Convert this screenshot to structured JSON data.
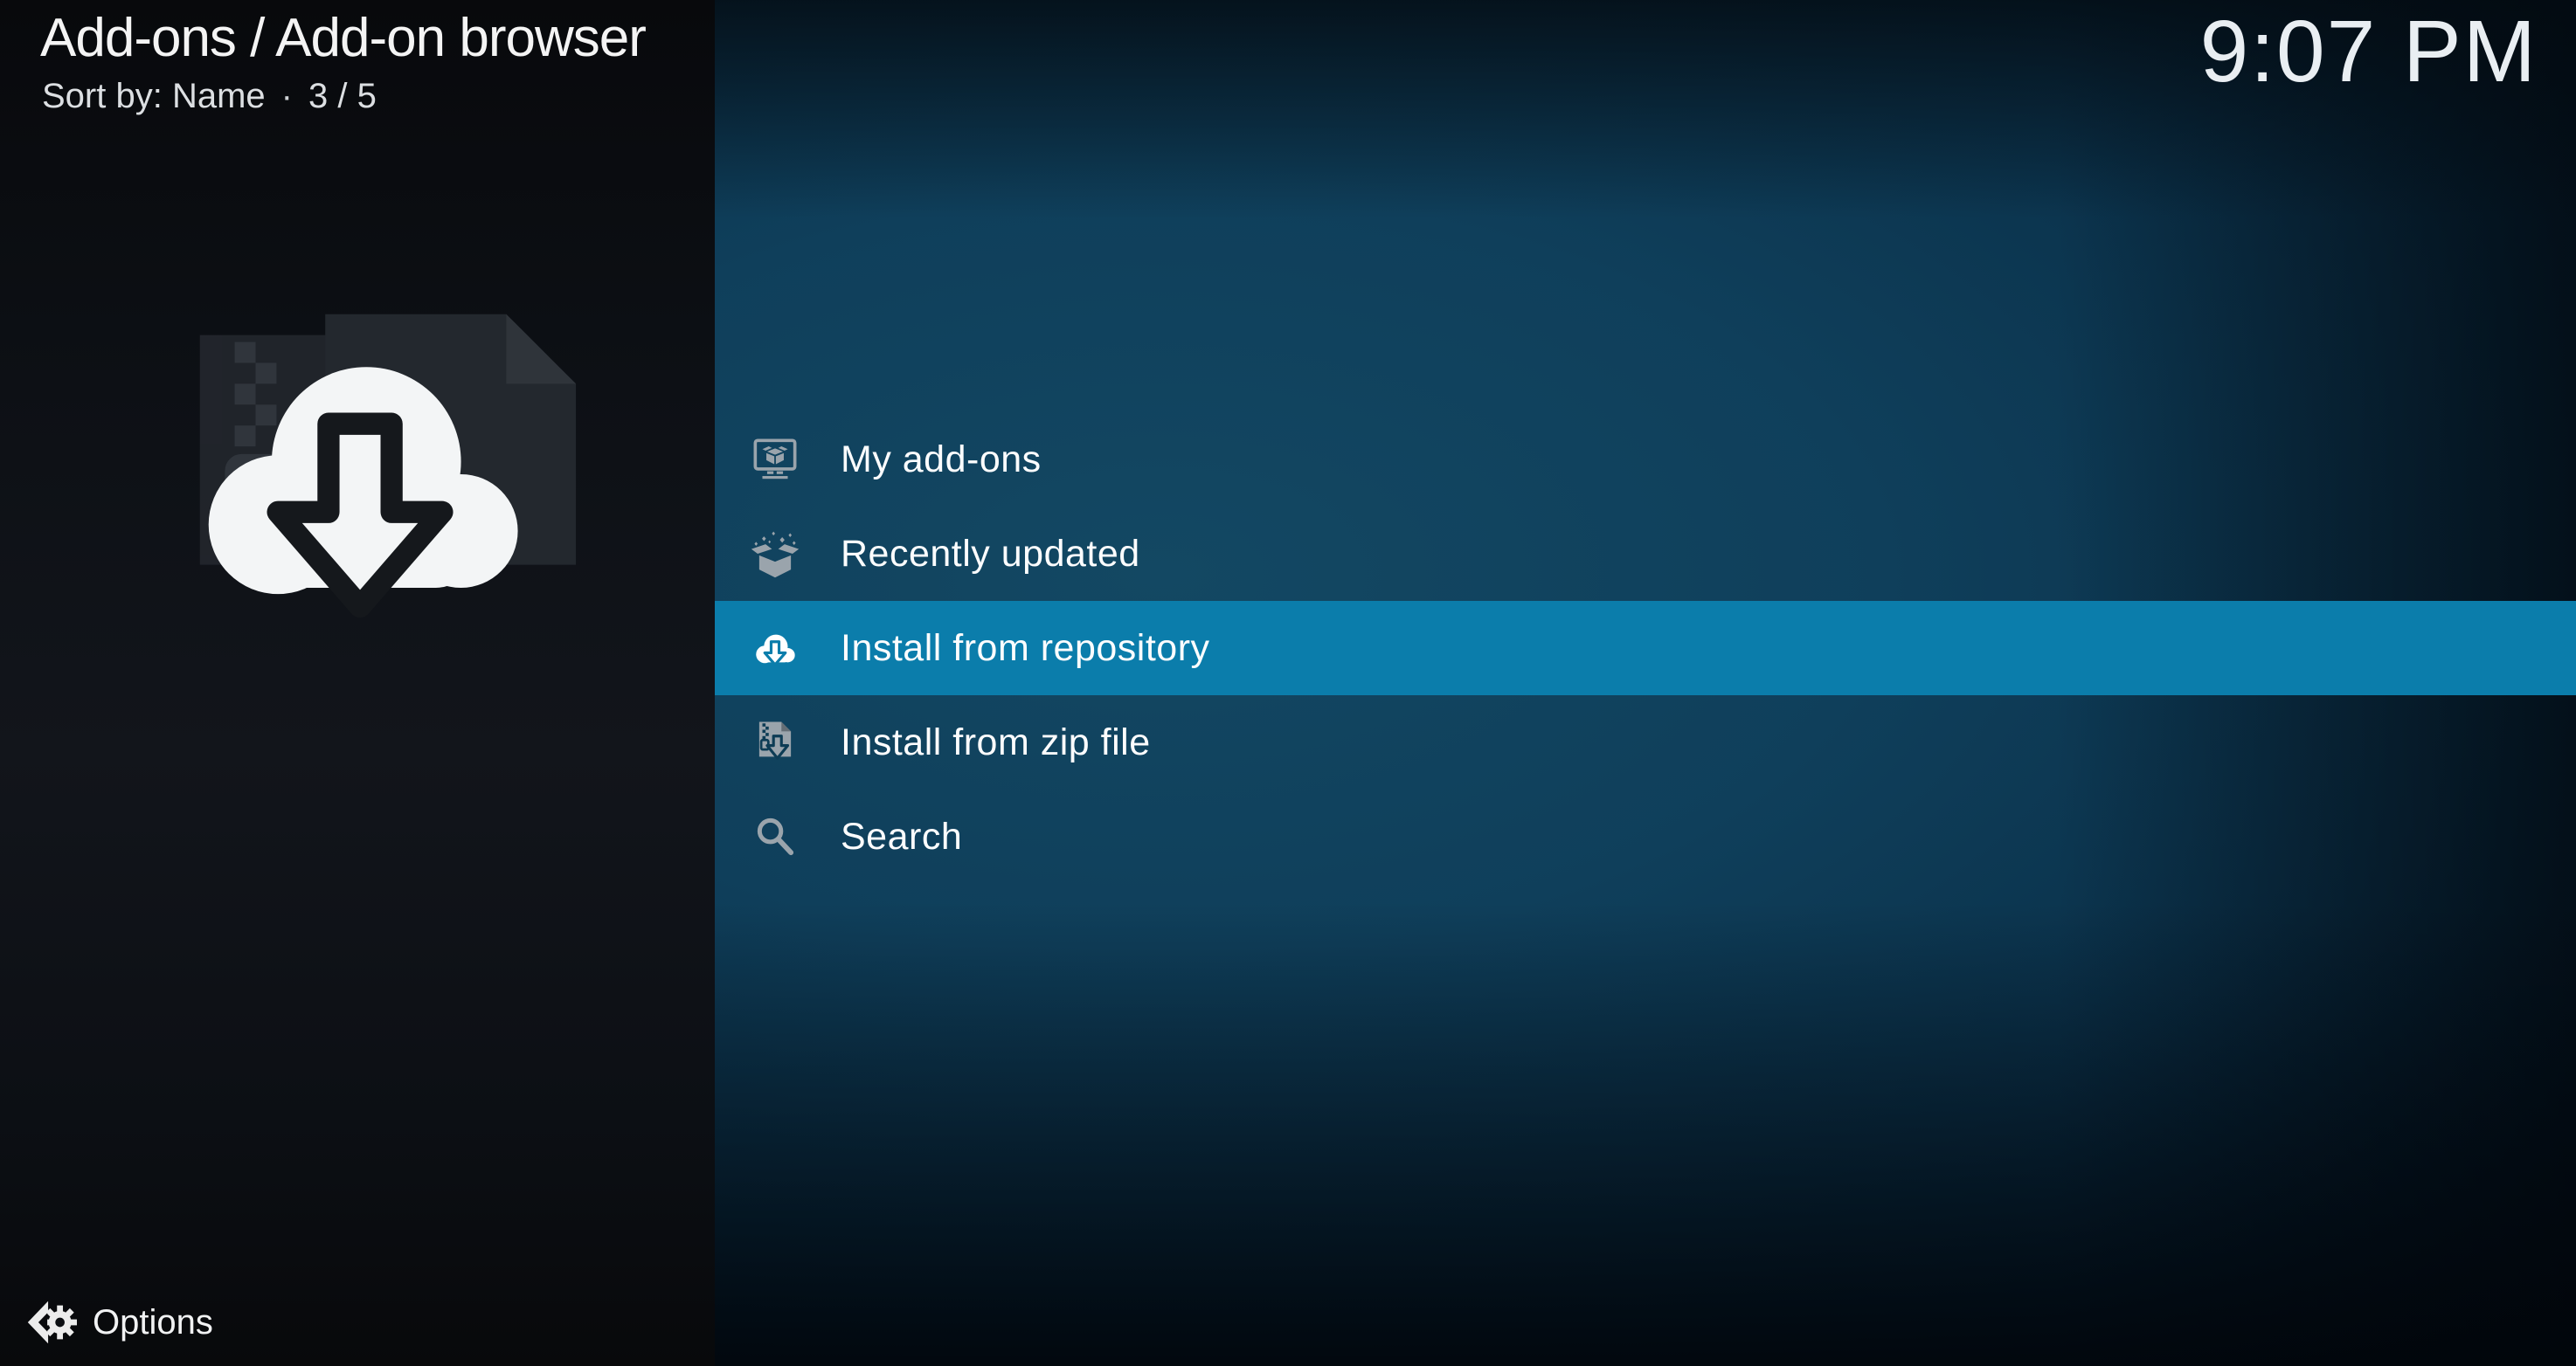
{
  "header": {
    "title": "Add-ons / Add-on browser",
    "sort_label": "Sort by: Name",
    "separator": "·",
    "item_position": "3 / 5",
    "clock": "9:07 PM"
  },
  "left_panel": {
    "artwork_icon": "cloud-download-icon",
    "options_label": "Options"
  },
  "menu": {
    "items": [
      {
        "label": "My add-ons",
        "icon": "my-addons-icon",
        "selected": false
      },
      {
        "label": "Recently updated",
        "icon": "recently-updated-icon",
        "selected": false
      },
      {
        "label": "Install from repository",
        "icon": "cloud-download-icon",
        "selected": true
      },
      {
        "label": "Install from zip file",
        "icon": "zip-file-icon",
        "selected": false
      },
      {
        "label": "Search",
        "icon": "search-icon",
        "selected": false
      }
    ]
  },
  "colors": {
    "highlight": "#0b7dab",
    "panel_bg": "#0d3c55",
    "icon_gray": "#9aa4ac",
    "menu_text": "#ffffff"
  }
}
